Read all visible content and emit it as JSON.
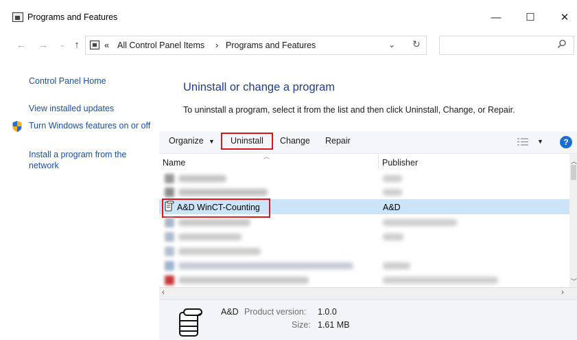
{
  "window": {
    "title": "Programs and Features",
    "controls": {
      "minimize": "—",
      "maximize": "☐",
      "close": "✕"
    }
  },
  "address_bar": {
    "overflow": "«",
    "crumbs": [
      "All Control Panel Items",
      "Programs and Features"
    ],
    "separator": "›",
    "search_placeholder": ""
  },
  "left_pane": {
    "links": [
      "Control Panel Home",
      "View installed updates",
      "Turn Windows features on or off",
      "Install a program from the network"
    ]
  },
  "main": {
    "heading": "Uninstall or change a program",
    "description": "To uninstall a program, select it from the list and then click Uninstall, Change, or Repair."
  },
  "toolbar": {
    "organize": "Organize",
    "uninstall": "Uninstall",
    "change": "Change",
    "repair": "Repair",
    "help": "?"
  },
  "list": {
    "columns": [
      "Name",
      "Publisher"
    ],
    "selected": {
      "name": "A&D WinCT-Counting",
      "publisher": "A&D"
    },
    "accent": "#cce4f7"
  },
  "details": {
    "publisher": "A&D",
    "product_version_label": "Product version:",
    "product_version": "1.0.0",
    "size_label": "Size:",
    "size": "1.61 MB"
  }
}
